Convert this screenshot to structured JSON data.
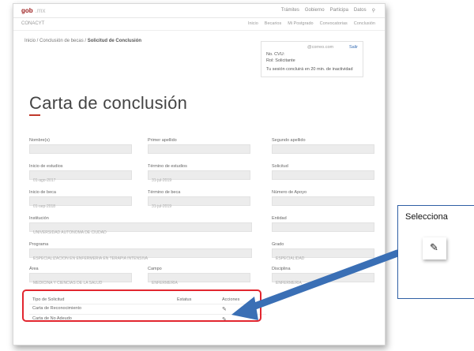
{
  "app": {
    "logo": "gob",
    "logo_sub": ".mx"
  },
  "toplinks": [
    "Trámites",
    "Gobierno",
    "Participa",
    "Datos"
  ],
  "section": {
    "title": "CONACYT",
    "nav": [
      "Inicio",
      "Becarios",
      "Mi Postgrado",
      "Convocatorias",
      "Conclusión"
    ]
  },
  "breadcrumb": {
    "path": "Inicio / Conclusión de becas / ",
    "current": "Solicitud de Conclusión"
  },
  "infobox": {
    "email": "@correo.com",
    "link": "Salir",
    "line1": "No. CVU:",
    "line2": "Rol: Solicitante",
    "note": "Tu sesión concluirá en 20 min. de inactividad"
  },
  "page_title": "Carta de conclusión",
  "fields": [
    {
      "label": "Nombre(s)",
      "value": ""
    },
    {
      "label": "Primer apellido",
      "value": ""
    },
    {
      "label": "Segundo apellido",
      "value": ""
    },
    {
      "label": "Inicio de estudios",
      "value": "01-ago-2017"
    },
    {
      "label": "Término de estudios",
      "value": "31-jul-2019"
    },
    {
      "label": "Solicitud",
      "value": ""
    },
    {
      "label": "Inicio de beca",
      "value": "01-sep-2018"
    },
    {
      "label": "Término de beca",
      "value": "31-jul-2019"
    },
    {
      "label": "Número de Apoyo",
      "value": ""
    },
    {
      "label": "Institución",
      "value": "UNIVERSIDAD AUTONOMA DE CIUDAD"
    },
    {
      "label": "Entidad",
      "value": ""
    },
    {
      "label": "Programa",
      "value": "ESPECIALIZACION EN ENFERMERIA EN TERAPIA INTENSIVA"
    },
    {
      "label": "Grado",
      "value": "ESPECIALIDAD"
    },
    {
      "label": "Área",
      "value": "MEDICINA Y CIENCIAS DE LA SALUD"
    },
    {
      "label": "Campo",
      "value": "ENFERMERIA"
    },
    {
      "label": "Disciplina",
      "value": "ENFERMERIA"
    }
  ],
  "table": {
    "headers": [
      "Tipo de Solicitud",
      "Estatus",
      "Acciones"
    ],
    "rows": [
      {
        "tipo": "Carta de Reconocimiento",
        "estatus": ""
      },
      {
        "tipo": "Carta de No Adeudo",
        "estatus": ""
      }
    ]
  },
  "callout": {
    "title": "Selecciona"
  },
  "colors": {
    "highlight": "#e2262f",
    "arrow": "#3a6fb5",
    "accent": "#c0392b"
  }
}
